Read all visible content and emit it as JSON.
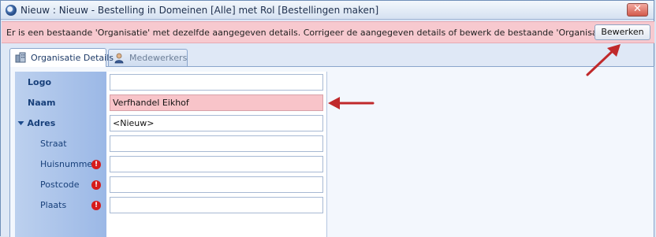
{
  "window": {
    "title": "Nieuw : Nieuw - Bestelling in Domeinen [Alle] met Rol [Bestellingen maken]",
    "close_label": "✕"
  },
  "error": {
    "message": "Er is een bestaande 'Organisatie' met dezelfde aangegeven details. Corrigeer de aangegeven details of bewerk de bestaande 'Organisatie'.",
    "button_label": "Bewerken"
  },
  "tabs": [
    {
      "label": "Organisatie Details",
      "active": true
    },
    {
      "label": "Medewerkers",
      "active": false
    }
  ],
  "form": {
    "logo": {
      "label": "Logo",
      "value": ""
    },
    "naam": {
      "label": "Naam",
      "value": "Verfhandel Eikhof"
    },
    "adres": {
      "label": "Adres",
      "value": "<Nieuw>"
    },
    "straat": {
      "label": "Straat",
      "value": ""
    },
    "huisnummer": {
      "label": "Huisnummer",
      "value": "",
      "required_icon": "!"
    },
    "postcode": {
      "label": "Postcode",
      "value": "",
      "required_icon": "!"
    },
    "plaats": {
      "label": "Plaats",
      "value": "",
      "required_icon": "!"
    }
  },
  "colors": {
    "error_bar": "#f7c9cf",
    "error_field": "#f8c4c9",
    "annotation_arrow": "#c0292b"
  }
}
